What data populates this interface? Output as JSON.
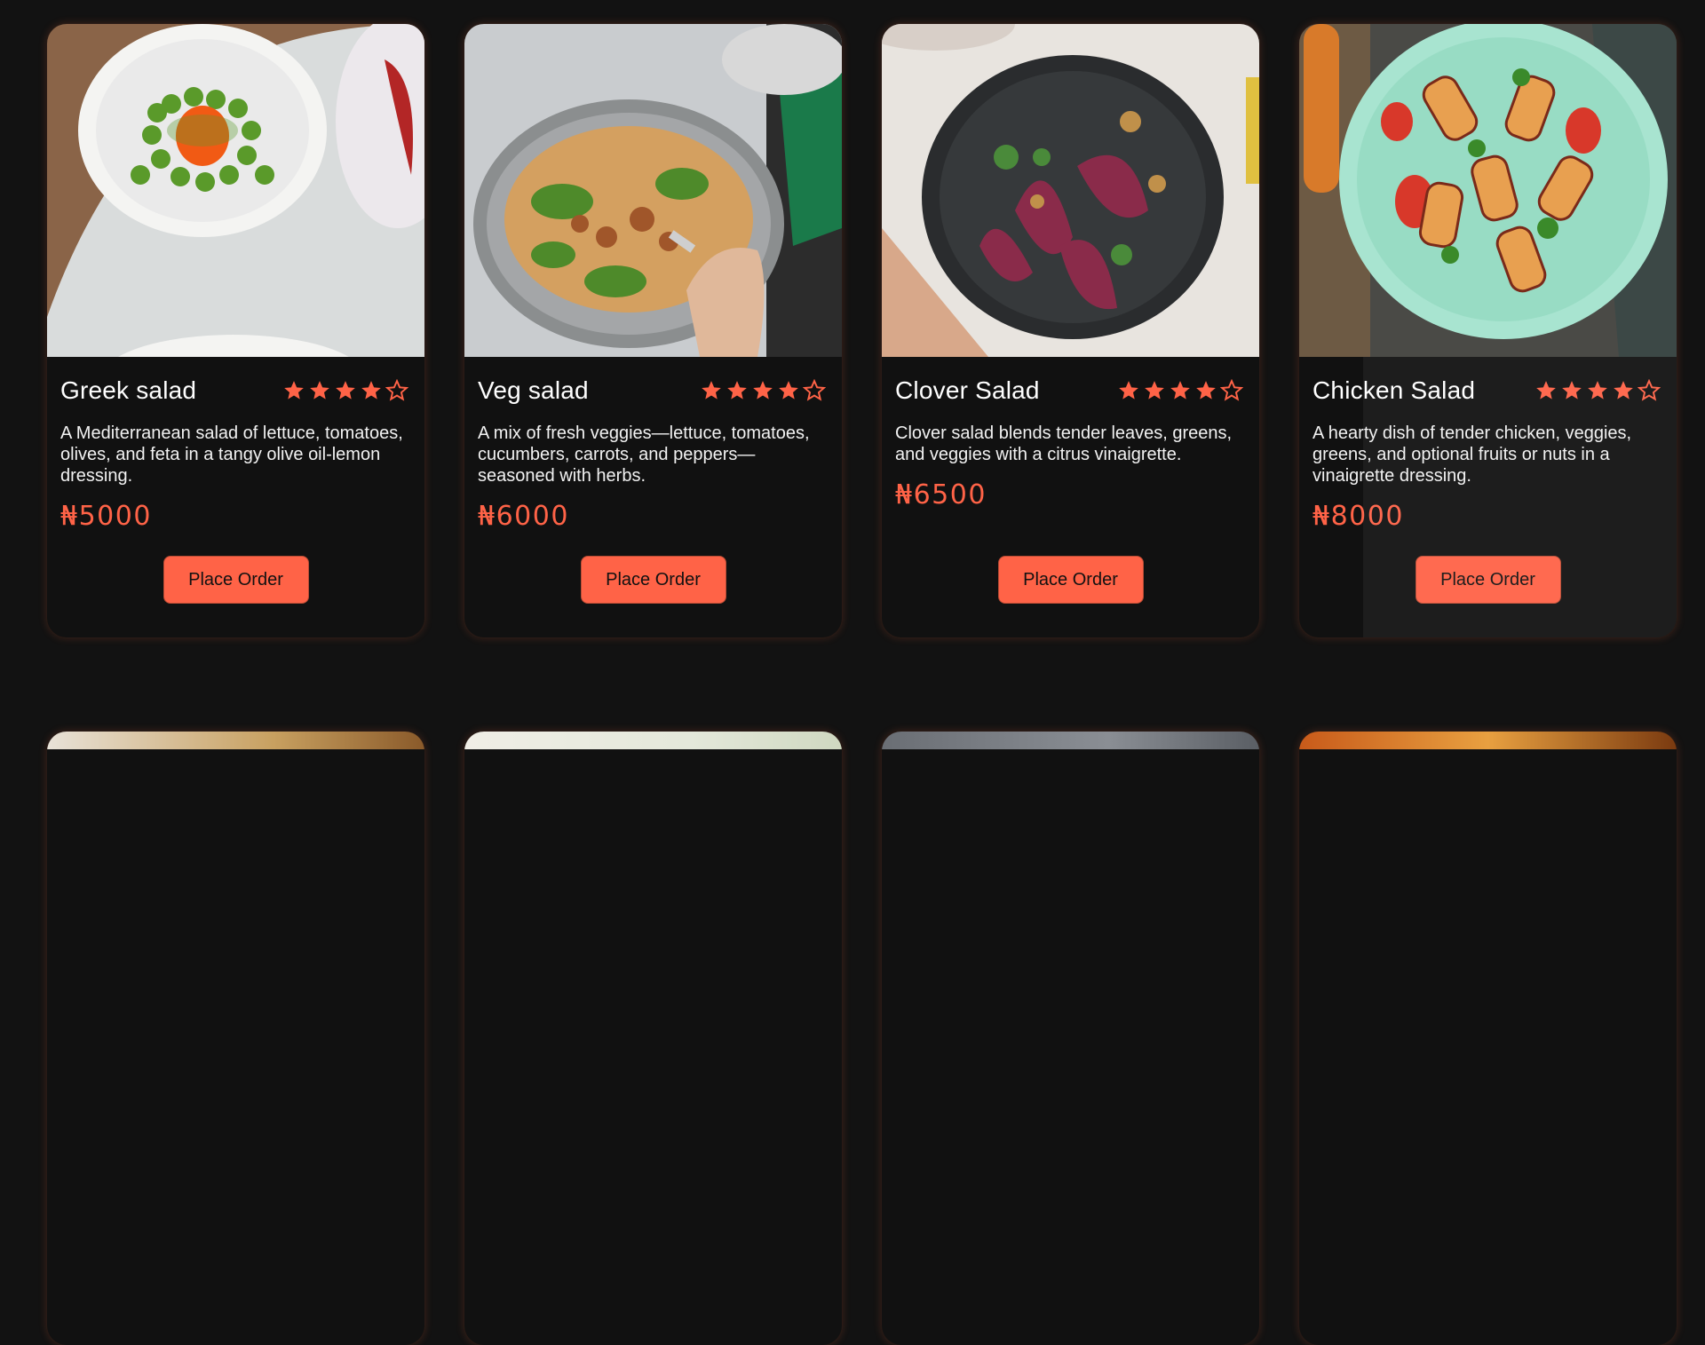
{
  "colors": {
    "background": "#121212",
    "card": "#111111",
    "accent": "#ff6347",
    "star": "#ff6347"
  },
  "currency_symbol": "₦",
  "button_label": "Place Order",
  "cards": [
    {
      "name": "Greek salad",
      "rating": 4,
      "max_rating": 5,
      "description": "A Mediterranean salad of lettuce, tomatoes, olives, and feta in a tangy olive oil-lemon dressing.",
      "price": "₦5000",
      "image_icon": "greek-salad-photo"
    },
    {
      "name": "Veg salad",
      "rating": 4,
      "max_rating": 5,
      "description": "A mix of fresh veggies—lettuce, tomatoes, cucumbers, carrots, and peppers—seasoned with herbs.",
      "price": "₦6000",
      "image_icon": "veg-salad-photo"
    },
    {
      "name": "Clover Salad",
      "rating": 4,
      "max_rating": 5,
      "description": "Clover salad blends tender leaves, greens, and veggies with a citrus vinaigrette.",
      "price": "₦6500",
      "image_icon": "clover-salad-photo"
    },
    {
      "name": "Chicken Salad",
      "rating": 4,
      "max_rating": 5,
      "description": "A hearty dish of tender chicken, veggies, greens, and optional fruits or nuts in a vinaigrette dressing.",
      "price": "₦8000",
      "image_icon": "chicken-salad-photo"
    }
  ]
}
